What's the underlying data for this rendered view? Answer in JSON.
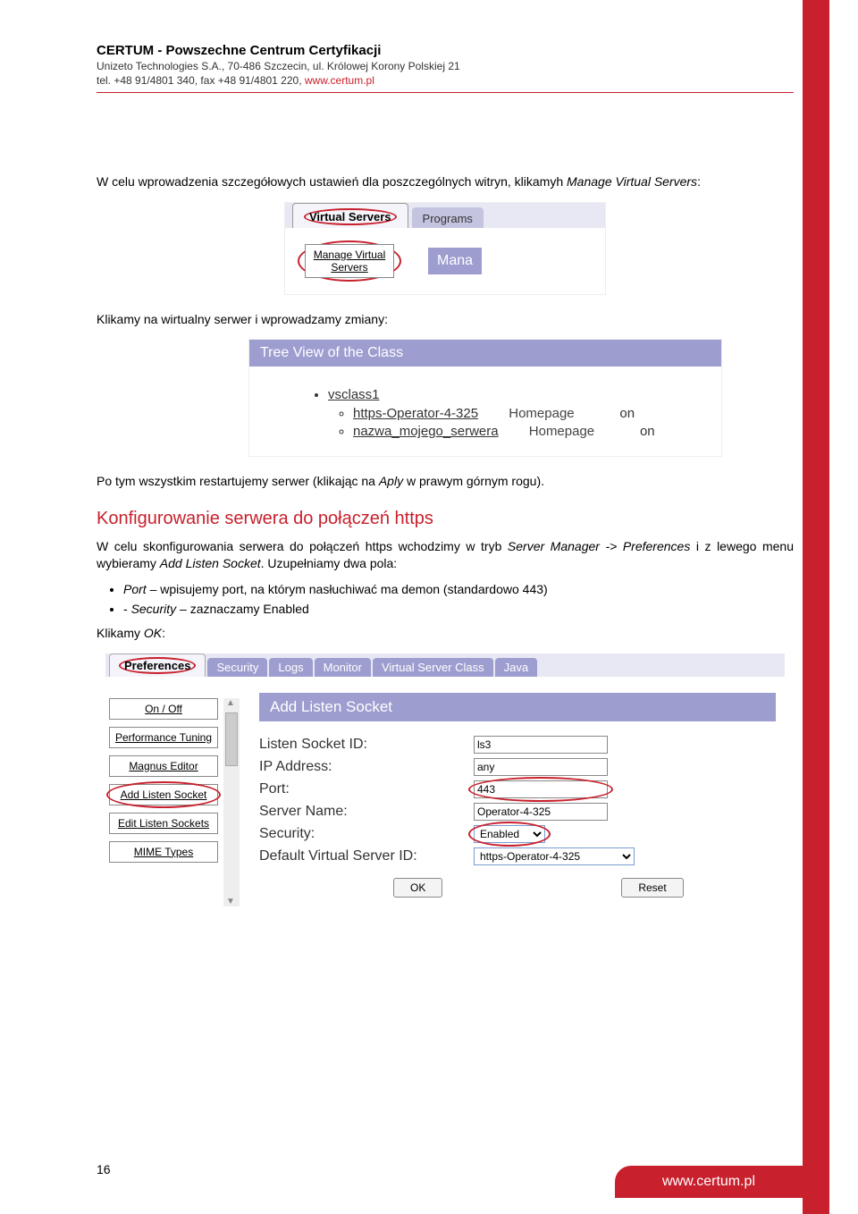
{
  "header": {
    "line1": "CERTUM - Powszechne Centrum Certyfikacji",
    "line2": "Unizeto Technologies S.A., 70-486 Szczecin, ul. Królowej Korony Polskiej 21",
    "line3_a": "tel. +48 91/4801 340, fax +48 91/4801 220, ",
    "line3_link": "www.certum.pl"
  },
  "para1_a": "W celu wprowadzenia szczegółowych ustawień dla poszczególnych witryn, klikamyh ",
  "para1_i1": "Manage Virtual Servers",
  "para1_b": ":",
  "shot1": {
    "tab_vs": "Virtual Servers",
    "tab_programs": "Programs",
    "btn_manage": "Manage Virtual Servers",
    "mana": "Mana"
  },
  "para2": "Klikamy na wirtualny serwer i wprowadzamy zmiany:",
  "shot2": {
    "title": "Tree View of the Class",
    "item1": "vsclass1",
    "item2a": "https-Operator-4-325",
    "item2b": "Homepage",
    "item2c": "on",
    "item3a": "nazwa_mojego_serwera",
    "item3b": "Homepage",
    "item3c": "on"
  },
  "para3_a": "Po tym wszystkim restartujemy serwer (klikając na ",
  "para3_i": "Aply",
  "para3_b": " w prawym górnym rogu).",
  "section_title": "Konfigurowanie serwera do połączeń https",
  "para4_a": "W celu skonfigurowania serwera do połączeń https wchodzimy w tryb ",
  "para4_i1": "Server Manager -> Preferences",
  "para4_b": " i z lewego menu wybieramy ",
  "para4_i2": "Add Listen Socket",
  "para4_c": ". Uzupełniamy dwa pola:",
  "bullet1_i": "Port",
  "bullet1_t": " – wpisujemy port, na którym nasłuchiwać ma demon (standardowo 443)",
  "bullet2_a": "- ",
  "bullet2_i": "Security",
  "bullet2_t": " – zaznaczamy Enabled",
  "para5_a": "Klikamy ",
  "para5_i": "OK",
  "para5_b": ":",
  "shot3": {
    "tabs": {
      "preferences": "Preferences",
      "security": "Security",
      "logs": "Logs",
      "monitor": "Monitor",
      "vsc": "Virtual Server Class",
      "java": "Java"
    },
    "sidebar": {
      "onoff": "On / Off",
      "perf": "Performance Tuning",
      "magnus": "Magnus Editor",
      "add": "Add Listen Socket",
      "edit": "Edit Listen Sockets",
      "mime": "MIME Types"
    },
    "form": {
      "title": "Add Listen Socket",
      "l_id": "Listen Socket ID:",
      "v_id": "ls3",
      "l_ip": "IP Address:",
      "v_ip": "any",
      "l_port": "Port:",
      "v_port": "443",
      "l_name": "Server Name:",
      "v_name": "Operator-4-325",
      "l_sec": "Security:",
      "v_sec": "Enabled",
      "l_dvs": "Default Virtual Server ID:",
      "v_dvs": "https-Operator-4-325",
      "btn_ok": "OK",
      "btn_reset": "Reset"
    }
  },
  "page_num": "16",
  "footer": "www.certum.pl"
}
